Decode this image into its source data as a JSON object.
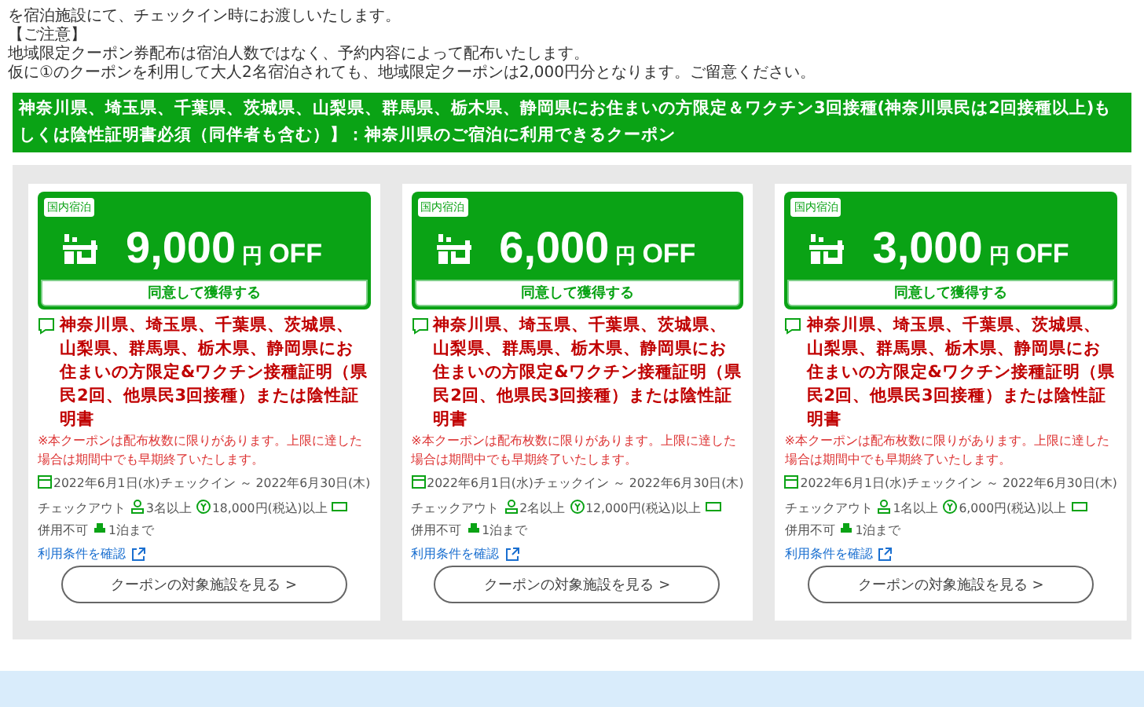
{
  "notice": {
    "lines": [
      "を宿泊施設にて、チェックイン時にお渡しいたします。",
      "【ご注意】",
      "地域限定クーポン券配布は宿泊人数ではなく、予約内容によって配布いたします。",
      "仮に①のクーポンを利用して大人2名宿泊されても、地域限定クーポンは2,000円分となります。ご留意ください。"
    ]
  },
  "banner": {
    "text": "神奈川県、埼玉県、千葉県、茨城県、山梨県、群馬県、栃木県、静岡県にお住まいの方限定＆ワクチン3回接種(神奈川県民は2回接種以上)もしくは陰性証明書必須（同伴者も含む）】：神奈川県のご宿泊に利用できるクーポン"
  },
  "coupons": [
    {
      "tag": "国内宿泊",
      "amount": "9,000",
      "unit": "円",
      "off": "OFF",
      "claim_button": "同意して獲得する",
      "condition": "神奈川県、埼玉県、千葉県、茨城県、山梨県、群馬県、栃木県、静岡県にお住まいの方限定&ワクチン接種証明（県民2回、他県民3回接種）または陰性証明書",
      "note": "※本クーポンは配布枚数に限りがあります。上限に達した場合は期間中でも早期終了いたします。",
      "period": "2022年6月1日(水)チェックイン ～ 2022年6月30日(木)",
      "checkout": "チェックアウト",
      "people": "3名以上",
      "min_price": "18,000円(税込)以上",
      "combine": "併用不可",
      "nights": "1泊まで",
      "terms_link": "利用条件を確認",
      "facilities_button": "クーポンの対象施設を見る >"
    },
    {
      "tag": "国内宿泊",
      "amount": "6,000",
      "unit": "円",
      "off": "OFF",
      "claim_button": "同意して獲得する",
      "condition": "神奈川県、埼玉県、千葉県、茨城県、山梨県、群馬県、栃木県、静岡県にお住まいの方限定&ワクチン接種証明（県民2回、他県民3回接種）または陰性証明書",
      "note": "※本クーポンは配布枚数に限りがあります。上限に達した場合は期間中でも早期終了いたします。",
      "period": "2022年6月1日(水)チェックイン ～ 2022年6月30日(木)",
      "checkout": "チェックアウト",
      "people": "2名以上",
      "min_price": "12,000円(税込)以上",
      "combine": "併用不可",
      "nights": "1泊まで",
      "terms_link": "利用条件を確認",
      "facilities_button": "クーポンの対象施設を見る >"
    },
    {
      "tag": "国内宿泊",
      "amount": "3,000",
      "unit": "円",
      "off": "OFF",
      "claim_button": "同意して獲得する",
      "condition": "神奈川県、埼玉県、千葉県、茨城県、山梨県、群馬県、栃木県、静岡県にお住まいの方限定&ワクチン接種証明（県民2回、他県民3回接種）または陰性証明書",
      "note": "※本クーポンは配布枚数に限りがあります。上限に達した場合は期間中でも早期終了いたします。",
      "period": "2022年6月1日(水)チェックイン ～ 2022年6月30日(木)",
      "checkout": "チェックアウト",
      "people": "1名以上",
      "min_price": "6,000円(税込)以上",
      "combine": "併用不可",
      "nights": "1泊まで",
      "terms_link": "利用条件を確認",
      "facilities_button": "クーポンの対象施設を見る >"
    }
  ]
}
